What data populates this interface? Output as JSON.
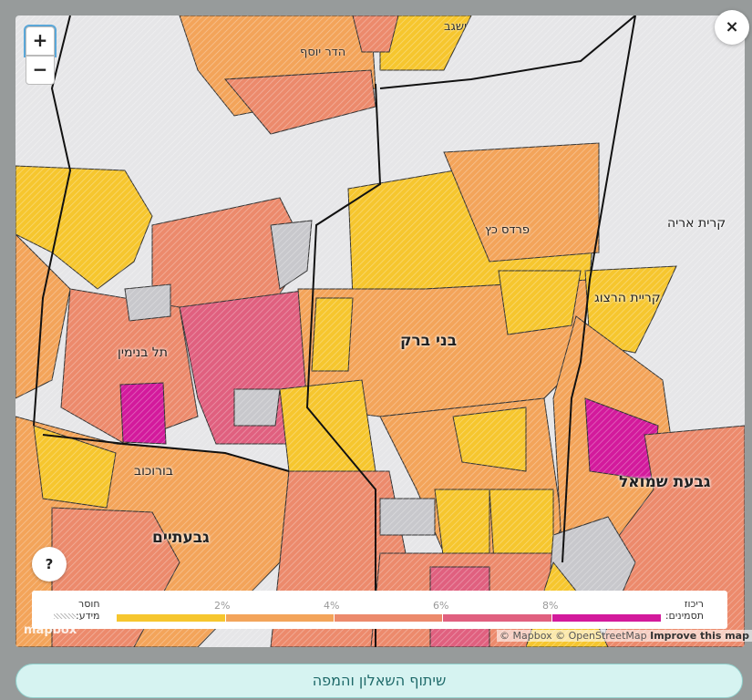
{
  "map": {
    "zoom_in": "+",
    "zoom_out": "−",
    "close": "×",
    "help": "?",
    "labels": {
      "bnei_brak": "בני ברק",
      "givat_shmuel": "גבעת שמואל",
      "givatayim": "גבעתיים",
      "tel_binyamin": "תל בנימין",
      "borochov": "בורוכוב",
      "pardes_katz": "פרדס כץ",
      "kiryat_arye": "קרית אריה",
      "kiryat_herzog": "קריית הרצוג",
      "hadar_yosef": "הדר יוסף",
      "yishgav": "ישגב"
    },
    "colors": {
      "c0": "#f6c62e",
      "c1": "#f3a45a",
      "c2": "#ec8a6c",
      "c3": "#e0607f",
      "c4": "#d31a9c",
      "nodata": "#c8c8cc",
      "bg": "#e6e6e8"
    }
  },
  "legend": {
    "title": "ריכוז",
    "title2": "תסמינים:",
    "ticks": [
      "2%",
      "4%",
      "6%",
      "8%"
    ],
    "missing": "חוסר",
    "missing2": "מידע:"
  },
  "attribution": {
    "text": "© Mapbox © OpenStreetMap",
    "improve": "Improve this map",
    "logo": "mapbox"
  },
  "share_button": "שיתוף השאלון והמפה"
}
